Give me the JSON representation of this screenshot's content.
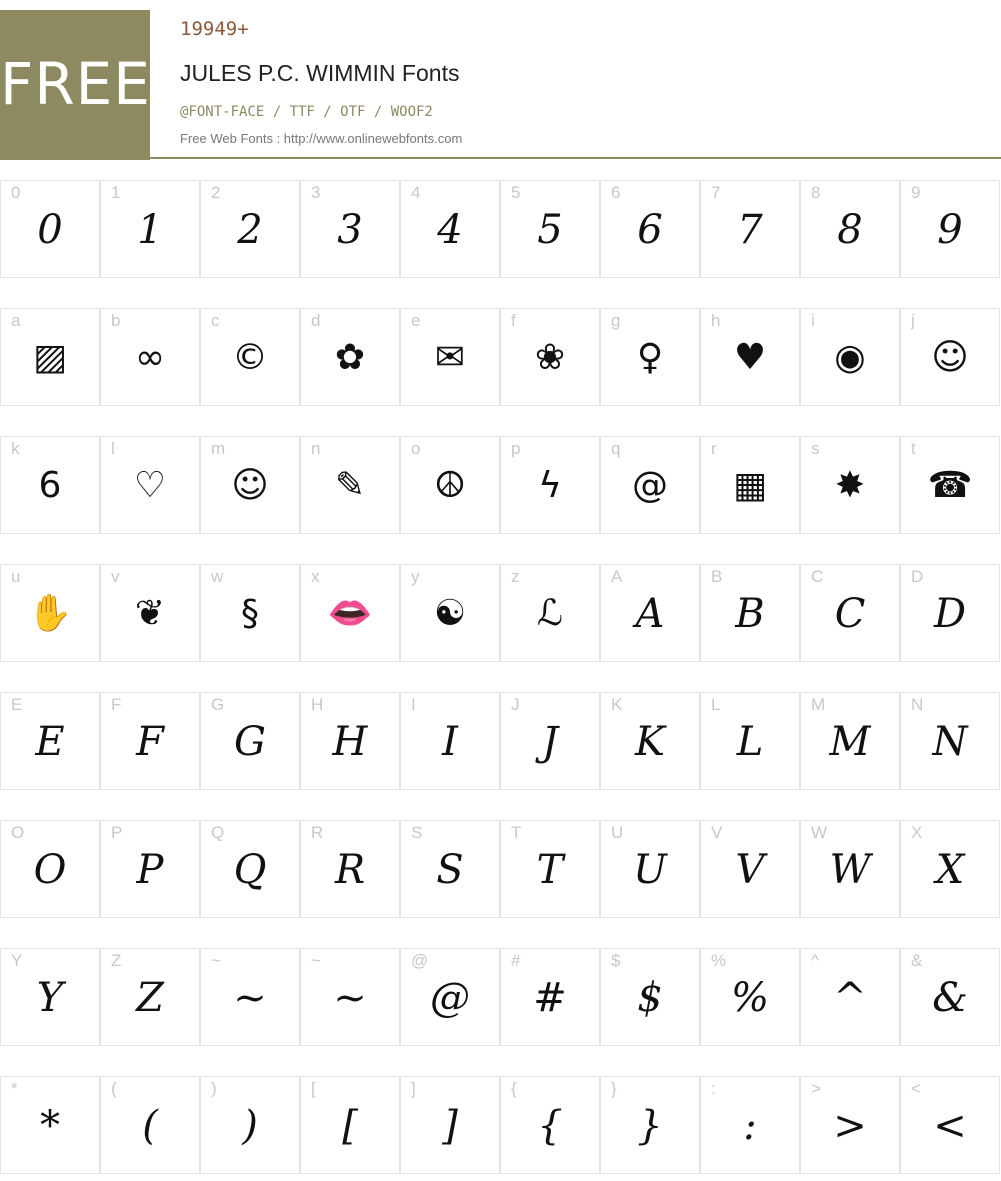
{
  "header": {
    "free_label": "FREE",
    "count": "19949+",
    "title": "JULES P.C. WIMMIN Fonts",
    "formats": "@FONT-FACE / TTF / OTF / WOOF2",
    "site": "Free Web Fonts : http://www.onlinewebfonts.com"
  },
  "colors": {
    "accent": "#8d8960",
    "count_color": "#8a5a3c",
    "border": "#e3e3e3"
  },
  "rows": [
    [
      {
        "label": "0",
        "glyph": "0"
      },
      {
        "label": "1",
        "glyph": "1"
      },
      {
        "label": "2",
        "glyph": "2"
      },
      {
        "label": "3",
        "glyph": "3"
      },
      {
        "label": "4",
        "glyph": "4"
      },
      {
        "label": "5",
        "glyph": "5"
      },
      {
        "label": "6",
        "glyph": "6"
      },
      {
        "label": "7",
        "glyph": "7"
      },
      {
        "label": "8",
        "glyph": "8"
      },
      {
        "label": "9",
        "glyph": "9"
      }
    ],
    [
      {
        "label": "a",
        "glyph": "▨",
        "icon": "framed-picture-icon"
      },
      {
        "label": "b",
        "glyph": "∞",
        "icon": "glasses-icon"
      },
      {
        "label": "c",
        "glyph": "©",
        "icon": "copyright-icon"
      },
      {
        "label": "d",
        "glyph": "✿",
        "icon": "flower-outline-icon"
      },
      {
        "label": "e",
        "glyph": "✉",
        "icon": "envelope-icon"
      },
      {
        "label": "f",
        "glyph": "❀",
        "icon": "flower-solid-icon"
      },
      {
        "label": "g",
        "glyph": "♀",
        "icon": "female-symbol-icon"
      },
      {
        "label": "h",
        "glyph": "♥",
        "icon": "heart-icon"
      },
      {
        "label": "i",
        "glyph": "◉",
        "icon": "eye-icon"
      },
      {
        "label": "j",
        "glyph": "☺",
        "icon": "doll-icon"
      }
    ],
    [
      {
        "label": "k",
        "glyph": "6",
        "icon": "curl-icon"
      },
      {
        "label": "l",
        "glyph": "♡",
        "icon": "heart-outline-icon"
      },
      {
        "label": "m",
        "glyph": "☺",
        "icon": "cat-face-icon"
      },
      {
        "label": "n",
        "glyph": "✎",
        "icon": "pencil-icon"
      },
      {
        "label": "o",
        "glyph": "☮",
        "icon": "peace-icon"
      },
      {
        "label": "p",
        "glyph": "ϟ",
        "icon": "zigzag-icon"
      },
      {
        "label": "q",
        "glyph": "@",
        "icon": "spiral-icon"
      },
      {
        "label": "r",
        "glyph": "▦",
        "icon": "heart-pattern-icon"
      },
      {
        "label": "s",
        "glyph": "✸",
        "icon": "starburst-icon"
      },
      {
        "label": "t",
        "glyph": "☎",
        "icon": "telephone-icon"
      }
    ],
    [
      {
        "label": "u",
        "glyph": "✋",
        "icon": "clapping-hands-icon"
      },
      {
        "label": "v",
        "glyph": "❦",
        "icon": "bouquet-icon"
      },
      {
        "label": "w",
        "glyph": "§",
        "icon": "squiggle-icon"
      },
      {
        "label": "x",
        "glyph": "👄",
        "icon": "lips-icon"
      },
      {
        "label": "y",
        "glyph": "☯",
        "icon": "yin-yang-icon"
      },
      {
        "label": "z",
        "glyph": "ℒ",
        "icon": "crossed-symbol-icon"
      },
      {
        "label": "A",
        "glyph": "A"
      },
      {
        "label": "B",
        "glyph": "B"
      },
      {
        "label": "C",
        "glyph": "C"
      },
      {
        "label": "D",
        "glyph": "D"
      }
    ],
    [
      {
        "label": "E",
        "glyph": "E"
      },
      {
        "label": "F",
        "glyph": "F"
      },
      {
        "label": "G",
        "glyph": "G"
      },
      {
        "label": "H",
        "glyph": "H"
      },
      {
        "label": "I",
        "glyph": "I"
      },
      {
        "label": "J",
        "glyph": "J"
      },
      {
        "label": "K",
        "glyph": "K"
      },
      {
        "label": "L",
        "glyph": "L"
      },
      {
        "label": "M",
        "glyph": "M"
      },
      {
        "label": "N",
        "glyph": "N"
      }
    ],
    [
      {
        "label": "O",
        "glyph": "O"
      },
      {
        "label": "P",
        "glyph": "P"
      },
      {
        "label": "Q",
        "glyph": "Q"
      },
      {
        "label": "R",
        "glyph": "R"
      },
      {
        "label": "S",
        "glyph": "S"
      },
      {
        "label": "T",
        "glyph": "T"
      },
      {
        "label": "U",
        "glyph": "U"
      },
      {
        "label": "V",
        "glyph": "V"
      },
      {
        "label": "W",
        "glyph": "W"
      },
      {
        "label": "X",
        "glyph": "X"
      }
    ],
    [
      {
        "label": "Y",
        "glyph": "Y"
      },
      {
        "label": "Z",
        "glyph": "Z"
      },
      {
        "label": "~",
        "glyph": "~"
      },
      {
        "label": "~",
        "glyph": "~"
      },
      {
        "label": "@",
        "glyph": "@"
      },
      {
        "label": "#",
        "glyph": "#"
      },
      {
        "label": "$",
        "glyph": "$"
      },
      {
        "label": "%",
        "glyph": "%"
      },
      {
        "label": "^",
        "glyph": "^"
      },
      {
        "label": "&",
        "glyph": "&"
      }
    ],
    [
      {
        "label": "*",
        "glyph": "*"
      },
      {
        "label": "(",
        "glyph": "("
      },
      {
        "label": ")",
        "glyph": ")"
      },
      {
        "label": "[",
        "glyph": "["
      },
      {
        "label": "]",
        "glyph": "]"
      },
      {
        "label": "{",
        "glyph": "{"
      },
      {
        "label": "}",
        "glyph": "}"
      },
      {
        "label": ":",
        "glyph": ":"
      },
      {
        "label": ">",
        "glyph": ">"
      },
      {
        "label": "<",
        "glyph": "<"
      }
    ]
  ]
}
